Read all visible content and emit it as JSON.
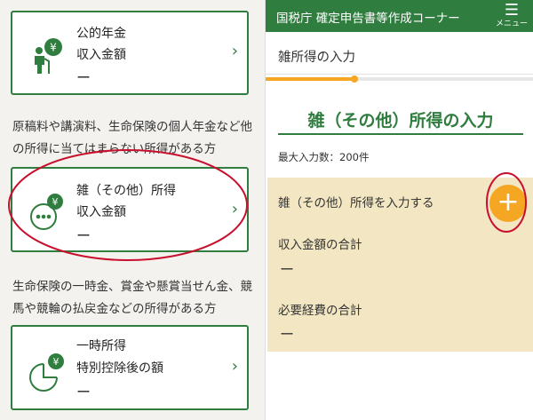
{
  "left": {
    "pension_card": {
      "title": "公的年金",
      "field_label": "収入金額",
      "value": "ー"
    },
    "misc_description": [
      "原稿料や講演料、生命保険の個人年金など他",
      "の所得に当てはまらない所得がある方"
    ],
    "misc_card": {
      "title": "雑（その他）所得",
      "field_label": "収入金額",
      "value": "ー"
    },
    "temporary_description": [
      "生命保険の一時金、賞金や懸賞当せん金、競",
      "馬や競輪の払戻金などの所得がある方"
    ],
    "temporary_card": {
      "title": "一時所得",
      "field_label": "特別控除後の額",
      "value": "ー"
    },
    "icon_yen": "¥",
    "chevron": "›"
  },
  "right": {
    "header_title": "国税庁 確定申告書等作成コーナー",
    "menu_icon": "☰",
    "menu_label": "メニュー",
    "page_title": "雑所得の入力",
    "progress": 0.33,
    "section_title": "雑（その他）所得の入力",
    "max_entries": "最大入力数：200件",
    "add_label": "雑（その他）所得を入力する",
    "add_button": "+",
    "income_total_label": "収入金額の合計",
    "income_total_value": "ー",
    "expense_total_label": "必要経費の合計",
    "expense_total_value": "ー"
  },
  "colors": {
    "green": "#2f7d3f",
    "orange": "#f5a623",
    "panel": "#f2e6c3",
    "annotation_red": "#c8102e"
  }
}
